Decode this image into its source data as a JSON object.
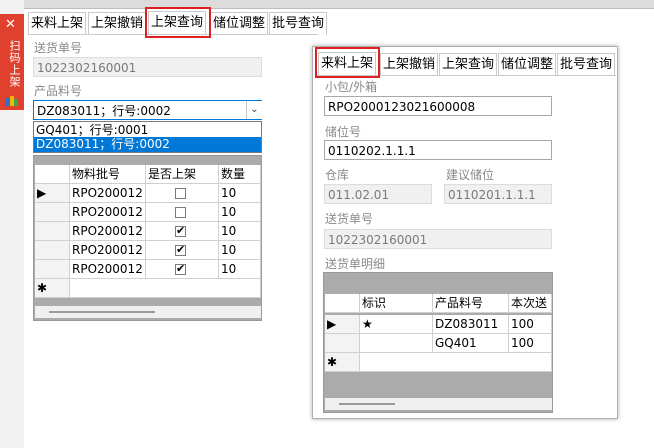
{
  "sidebar": {
    "title": "扫码上架",
    "close_glyph": "✕"
  },
  "bg_tabs": [
    "来料上架",
    "上架撤销",
    "上架查询",
    "储位调整",
    "批号查询"
  ],
  "bg": {
    "delivery_label": "送货单号",
    "delivery_value": "1022302160001",
    "product_label": "产品料号",
    "product_selected": "DZ083011；行号:0002",
    "dropdown_options": [
      "GQ401；行号:0001",
      "DZ083011；行号:0002"
    ],
    "grid": {
      "headers": [
        "物料批号",
        "是否上架",
        "数量"
      ],
      "rows": [
        {
          "marker": "▶",
          "batch": "RPO200012",
          "checked": false,
          "qty": "10"
        },
        {
          "marker": "",
          "batch": "RPO200012",
          "checked": false,
          "qty": "10"
        },
        {
          "marker": "",
          "batch": "RPO200012",
          "checked": true,
          "qty": "10"
        },
        {
          "marker": "",
          "batch": "RPO200012",
          "checked": true,
          "qty": "10"
        },
        {
          "marker": "",
          "batch": "RPO200012",
          "checked": true,
          "qty": "10"
        }
      ],
      "new_row_marker": "✱"
    }
  },
  "fg_tabs": [
    "来料上架",
    "上架撤销",
    "上架查询",
    "储位调整",
    "批号查询"
  ],
  "fg": {
    "package_label": "小包/外箱",
    "package_value": "RPO2000123021600008",
    "location_label": "储位号",
    "location_value": "0110202.1.1.1",
    "warehouse_label": "仓库",
    "warehouse_value": "011.02.01",
    "suggest_label": "建议储位",
    "suggest_value": "0110201.1.1.1",
    "delivery_label": "送货单号",
    "delivery_value": "1022302160001",
    "detail_label": "送货单明细",
    "grid": {
      "headers": [
        "标识",
        "产品料号",
        "本次送"
      ],
      "rows": [
        {
          "marker": "▶",
          "flag": "★",
          "product": "DZ083011",
          "qty": "100"
        },
        {
          "marker": "",
          "flag": "",
          "product": "GQ401",
          "qty": "100"
        }
      ],
      "new_row_marker": "✱"
    }
  },
  "colors": {
    "highlight": "#e02020",
    "select_blue": "#0078d7",
    "sidebar_red": "#e0412e"
  }
}
